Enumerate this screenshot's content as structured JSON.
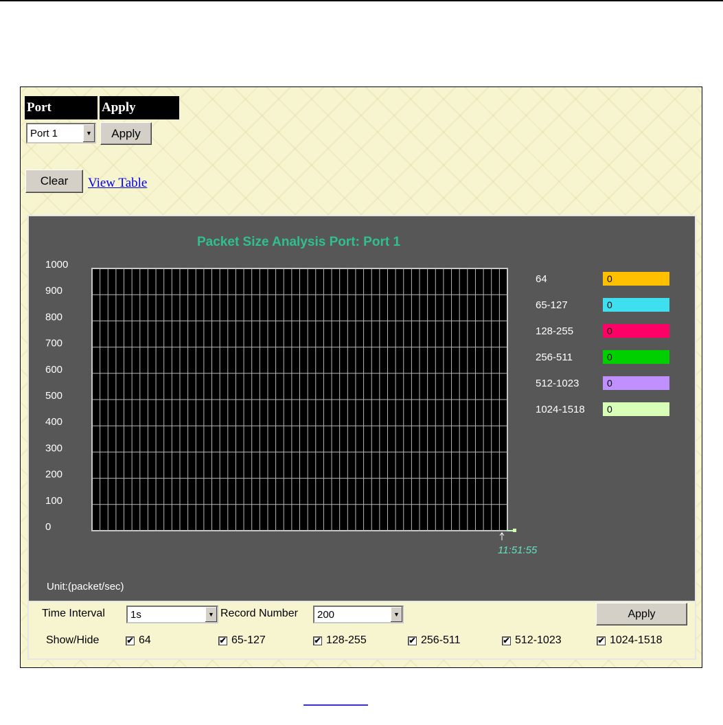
{
  "port_header": {
    "port": "Port",
    "apply": "Apply"
  },
  "port_select": {
    "value": "Port 1"
  },
  "apply_label": "Apply",
  "clear_label": "Clear",
  "view_table_label": "View Table",
  "chart_data": {
    "type": "line",
    "title": "Packet Size Analysis   Port: Port 1",
    "y_ticks": [
      "1000",
      "900",
      "800",
      "700",
      "600",
      "500",
      "400",
      "300",
      "200",
      "100",
      "0"
    ],
    "ylim": [
      0,
      1000
    ],
    "x_time_label": "11:51:55",
    "unit_label": "Unit:(packet/sec)",
    "grid": true,
    "legend_placement": "right",
    "series": [
      {
        "name": "64",
        "value": "0",
        "color": "#ffc000"
      },
      {
        "name": "65-127",
        "value": "0",
        "color": "#3ee0f0"
      },
      {
        "name": "128-255",
        "value": "0",
        "color": "#ff0066"
      },
      {
        "name": "256-511",
        "value": "0",
        "color": "#00d000"
      },
      {
        "name": "512-1023",
        "value": "0",
        "color": "#c090ff"
      },
      {
        "name": "1024-1518",
        "value": "0",
        "color": "#d8ffb8"
      }
    ],
    "title_color": "#30c090",
    "time_color": "#66e0c0"
  },
  "controls": {
    "time_interval_label": "Time Interval",
    "time_interval_value": "1s",
    "record_number_label": "Record Number",
    "record_number_value": "200",
    "apply_label": "Apply",
    "show_hide_label": "Show/Hide",
    "checks": [
      "64",
      "65-127",
      "128-255",
      "256-511",
      "512-1023",
      "1024-1518"
    ],
    "check_mark": "✔"
  }
}
